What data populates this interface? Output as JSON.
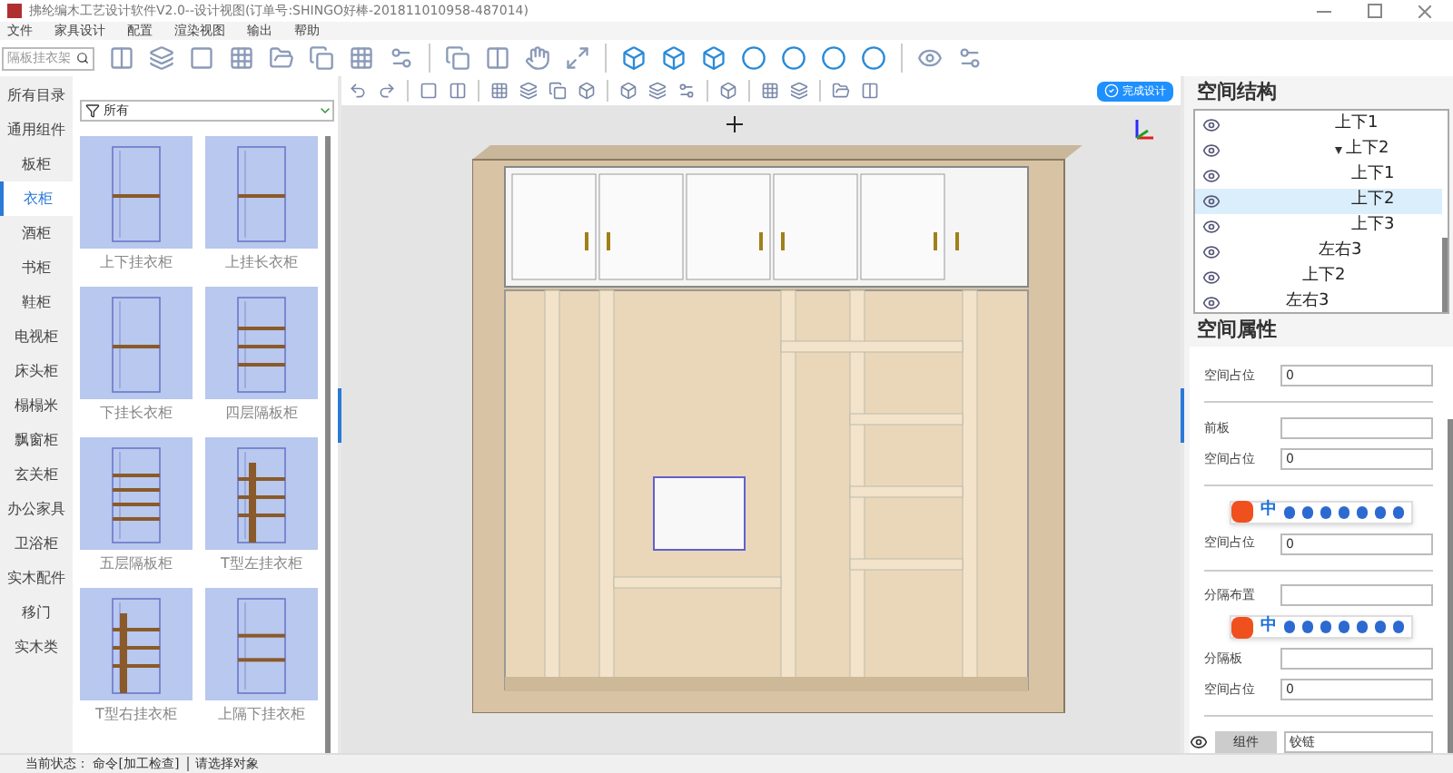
{
  "window": {
    "title": "拂纶编木工艺设计软件V2.0--设计视图(订单号:SHINGO好棒-201811010958-487014)"
  },
  "menu": [
    "文件",
    "家具设计",
    "配置",
    "渲染视图",
    "输出",
    "帮助"
  ],
  "search": {
    "placeholder": "隔板挂衣架"
  },
  "categories": [
    {
      "label": "所有目录",
      "selected": false
    },
    {
      "label": "通用组件",
      "selected": false
    },
    {
      "label": "板柜",
      "selected": false
    },
    {
      "label": "衣柜",
      "selected": true
    },
    {
      "label": "酒柜",
      "selected": false
    },
    {
      "label": "书柜",
      "selected": false
    },
    {
      "label": "鞋柜",
      "selected": false
    },
    {
      "label": "电视柜",
      "selected": false
    },
    {
      "label": "床头柜",
      "selected": false
    },
    {
      "label": "榻榻米",
      "selected": false
    },
    {
      "label": "飘窗柜",
      "selected": false
    },
    {
      "label": "玄关柜",
      "selected": false
    },
    {
      "label": "办公家具",
      "selected": false
    },
    {
      "label": "卫浴柜",
      "selected": false
    },
    {
      "label": "实木配件",
      "selected": false
    },
    {
      "label": "移门",
      "selected": false
    },
    {
      "label": "实木类",
      "selected": false
    }
  ],
  "filter": {
    "value": "所有"
  },
  "templates": [
    {
      "label": "上下挂衣柜"
    },
    {
      "label": "上挂长衣柜"
    },
    {
      "label": "下挂长衣柜"
    },
    {
      "label": "四层隔板柜"
    },
    {
      "label": "五层隔板柜"
    },
    {
      "label": "T型左挂衣柜"
    },
    {
      "label": "T型右挂衣柜"
    },
    {
      "label": "上隔下挂衣柜"
    }
  ],
  "finish_button": "完成设计",
  "structure": {
    "title": "空间结构",
    "tree": [
      {
        "children": [
          {
            "children": [
              {
                "children": [
                  {
                    "label": "上下1",
                    "selected": false
                  },
                  {
                    "label": "上下2",
                    "selected": false,
                    "expanded": true,
                    "children": [
                      {
                        "label": "上下1",
                        "selected": false
                      },
                      {
                        "label": "上下2",
                        "selected": true
                      },
                      {
                        "label": "上下3",
                        "selected": false
                      }
                    ]
                  }
                ]
              },
              {
                "label": "左右3",
                "selected": false
              }
            ]
          },
          {
            "label": "上下2",
            "selected": false
          }
        ]
      },
      {
        "label": "左右3",
        "selected": false
      }
    ]
  },
  "properties": {
    "title": "空间属性",
    "rows": [
      {
        "kind": "field",
        "label": "空间占位",
        "value": "0"
      },
      {
        "kind": "divider"
      },
      {
        "kind": "field",
        "label": "前板",
        "value": ""
      },
      {
        "kind": "field",
        "label": "空间占位",
        "value": "0"
      },
      {
        "kind": "divider"
      },
      {
        "kind": "ime",
        "label": "中"
      },
      {
        "kind": "field",
        "label": "空间占位",
        "value": "0"
      },
      {
        "kind": "divider"
      },
      {
        "kind": "field",
        "label": "分隔布置",
        "value": ""
      },
      {
        "kind": "ime",
        "label": "中"
      },
      {
        "kind": "field",
        "label": "分隔板",
        "value": ""
      },
      {
        "kind": "field",
        "label": "空间占位",
        "value": "0"
      },
      {
        "kind": "divider"
      },
      {
        "kind": "component",
        "label": "组件",
        "value": "铰链"
      }
    ]
  },
  "status_bar": {
    "state": "当前状态： 命令[加工检查]",
    "hint": "请选择对象"
  }
}
